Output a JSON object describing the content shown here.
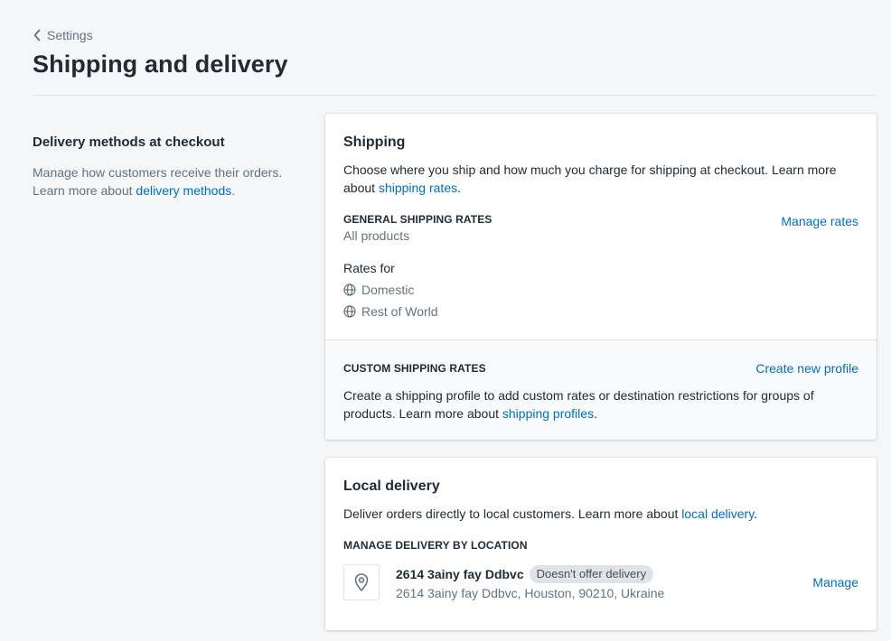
{
  "breadcrumb": {
    "label": "Settings"
  },
  "page": {
    "title": "Shipping and delivery"
  },
  "annotation": {
    "title": "Delivery methods at checkout",
    "description_line1": "Manage how customers receive their orders.",
    "description_prefix": "Learn more about",
    "link": "delivery methods",
    "suffix": "."
  },
  "shipping": {
    "title": "Shipping",
    "description": "Choose where you ship and how much you charge for shipping at checkout. Learn more about",
    "link": "shipping rates",
    "suffix": ".",
    "general": {
      "heading": "GENERAL SHIPPING RATES",
      "subtitle": "All products",
      "action": "Manage rates",
      "rates_for": "Rates for",
      "zones": [
        "Domestic",
        "Rest of World"
      ]
    },
    "custom": {
      "heading": "CUSTOM SHIPPING RATES",
      "action": "Create new profile",
      "description": "Create a shipping profile to add custom rates or destination restrictions for groups of products. Learn more about",
      "link": "shipping profiles",
      "suffix": "."
    }
  },
  "local_delivery": {
    "title": "Local delivery",
    "description": "Deliver orders directly to local customers. Learn more about",
    "link": "local delivery",
    "suffix": ".",
    "section_heading": "MANAGE DELIVERY BY LOCATION",
    "location": {
      "name": "2614 3ainy fay Ddbvc",
      "badge": "Doesn't offer delivery",
      "address": "2614 3ainy fay Ddbvc, Houston, 90210, Ukraine",
      "action": "Manage"
    }
  },
  "colors": {
    "link": "#006fbb",
    "background": "#f4f6f8",
    "text": "#212b36",
    "subdued": "#637381"
  },
  "icons": [
    "chevron-left-icon",
    "globe-icon",
    "location-pin-icon"
  ]
}
